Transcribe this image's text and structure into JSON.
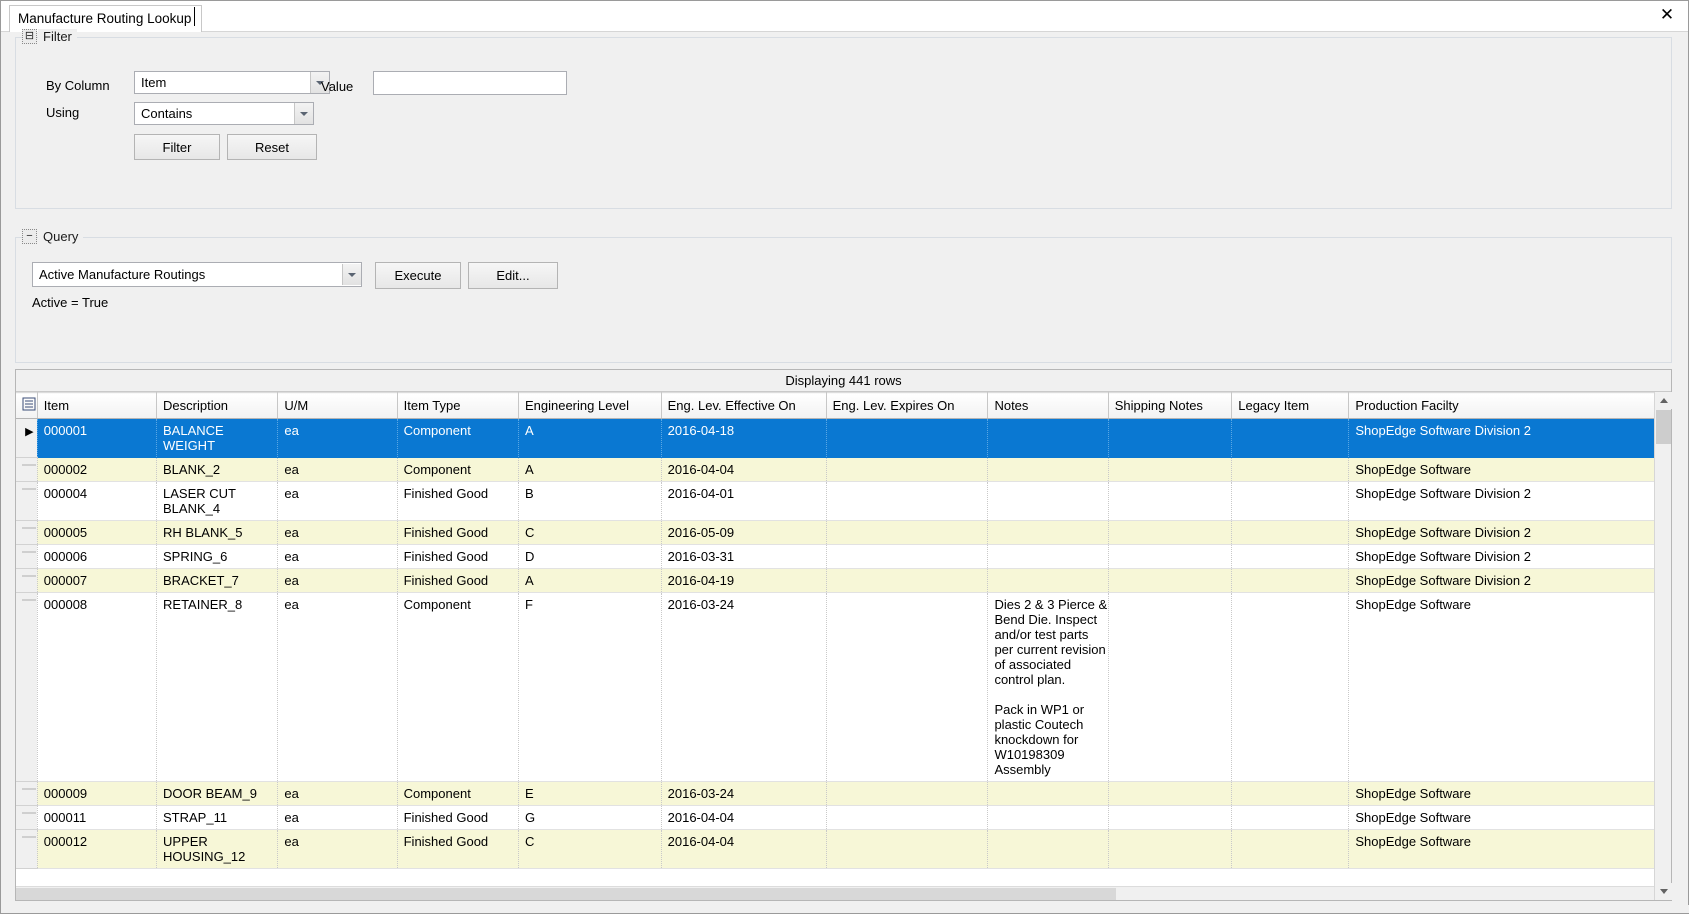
{
  "window": {
    "tab_title": "Manufacture Routing Lookup",
    "close_label": "✕"
  },
  "filter": {
    "legend": "Filter",
    "toggle_glyph": "⊟",
    "by_column_label": "By Column",
    "by_column_value": "Item",
    "value_label": "Value",
    "value_text": "",
    "using_label": "Using",
    "using_value": "Contains",
    "filter_button": "Filter",
    "reset_button": "Reset"
  },
  "query": {
    "legend": "Query",
    "toggle_glyph": "−",
    "selected_query": "Active Manufacture Routings",
    "execute_button": "Execute",
    "edit_button": "Edit...",
    "criteria_text": "Active = True"
  },
  "grid": {
    "status_text": "Displaying 441 rows",
    "row_marker": "▶",
    "columns": [
      "Item",
      "Description",
      "U/M",
      "Item Type",
      "Engineering Level",
      "Eng. Lev. Effective On",
      "Eng. Lev. Expires On",
      "Notes",
      "Shipping Notes",
      "Legacy Item",
      "Production Facilty"
    ],
    "rows": [
      {
        "item": "000001",
        "description": "BALANCE WEIGHT",
        "um": "ea",
        "item_type": "Component",
        "eng_level": "A",
        "eff_on": "2016-04-18",
        "exp_on": "",
        "notes": "",
        "shipping_notes": "",
        "legacy_item": "",
        "facility": "ShopEdge Software Division 2",
        "state": "selected"
      },
      {
        "item": "000002",
        "description": "BLANK_2",
        "um": "ea",
        "item_type": "Component",
        "eng_level": "A",
        "eff_on": "2016-04-04",
        "exp_on": "",
        "notes": "",
        "shipping_notes": "",
        "legacy_item": "",
        "facility": "ShopEdge Software",
        "state": "alt"
      },
      {
        "item": "000004",
        "description": "LASER CUT BLANK_4",
        "um": "ea",
        "item_type": "Finished Good",
        "eng_level": "B",
        "eff_on": "2016-04-01",
        "exp_on": "",
        "notes": "",
        "shipping_notes": "",
        "legacy_item": "",
        "facility": "ShopEdge Software Division 2",
        "state": "plain"
      },
      {
        "item": "000005",
        "description": "RH BLANK_5",
        "um": "ea",
        "item_type": "Finished Good",
        "eng_level": "C",
        "eff_on": "2016-05-09",
        "exp_on": "",
        "notes": "",
        "shipping_notes": "",
        "legacy_item": "",
        "facility": "ShopEdge Software Division 2",
        "state": "alt"
      },
      {
        "item": "000006",
        "description": "SPRING_6",
        "um": "ea",
        "item_type": "Finished Good",
        "eng_level": "D",
        "eff_on": "2016-03-31",
        "exp_on": "",
        "notes": "",
        "shipping_notes": "",
        "legacy_item": "",
        "facility": "ShopEdge Software Division 2",
        "state": "plain"
      },
      {
        "item": "000007",
        "description": "BRACKET_7",
        "um": "ea",
        "item_type": "Finished Good",
        "eng_level": "A",
        "eff_on": "2016-04-19",
        "exp_on": "",
        "notes": "",
        "shipping_notes": "",
        "legacy_item": "",
        "facility": "ShopEdge Software Division 2",
        "state": "alt"
      },
      {
        "item": "000008",
        "description": "RETAINER_8",
        "um": "ea",
        "item_type": "Component",
        "eng_level": "F",
        "eff_on": "2016-03-24",
        "exp_on": "",
        "notes": "Dies 2 & 3 Pierce & Bend Die. Inspect and/or test parts per current revision of associated control plan.\n\nPack in WP1 or plastic Coutech knockdown for W10198309 Assembly",
        "shipping_notes": "",
        "legacy_item": "",
        "facility": "ShopEdge Software",
        "state": "plain"
      },
      {
        "item": "000009",
        "description": "DOOR BEAM_9",
        "um": "ea",
        "item_type": "Component",
        "eng_level": "E",
        "eff_on": "2016-03-24",
        "exp_on": "",
        "notes": "",
        "shipping_notes": "",
        "legacy_item": "",
        "facility": "ShopEdge Software",
        "state": "alt"
      },
      {
        "item": "000011",
        "description": "STRAP_11",
        "um": "ea",
        "item_type": "Finished Good",
        "eng_level": "G",
        "eff_on": "2016-04-04",
        "exp_on": "",
        "notes": "",
        "shipping_notes": "",
        "legacy_item": "",
        "facility": "ShopEdge Software",
        "state": "plain"
      },
      {
        "item": "000012",
        "description": "UPPER HOUSING_12",
        "um": "ea",
        "item_type": "Finished Good",
        "eng_level": "C",
        "eff_on": "2016-04-04",
        "exp_on": "",
        "notes": "",
        "shipping_notes": "",
        "legacy_item": "",
        "facility": "ShopEdge Software",
        "state": "alt"
      }
    ]
  },
  "colors": {
    "selection": "#0a78d2",
    "alt_row": "#f7f7d7",
    "chrome": "#f0f0f0"
  }
}
